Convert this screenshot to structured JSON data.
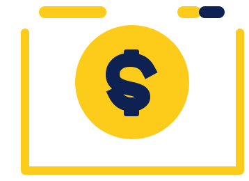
{
  "illustration": {
    "subject": "browser-window-with-dollar-coin",
    "colors": {
      "accent": "#FDCC1B",
      "dark": "#0D2252",
      "background": "#FFFFFF"
    },
    "icons": {
      "window": "browser-window-icon",
      "coin": "dollar-coin-icon",
      "symbol": "dollar-sign-icon"
    }
  }
}
